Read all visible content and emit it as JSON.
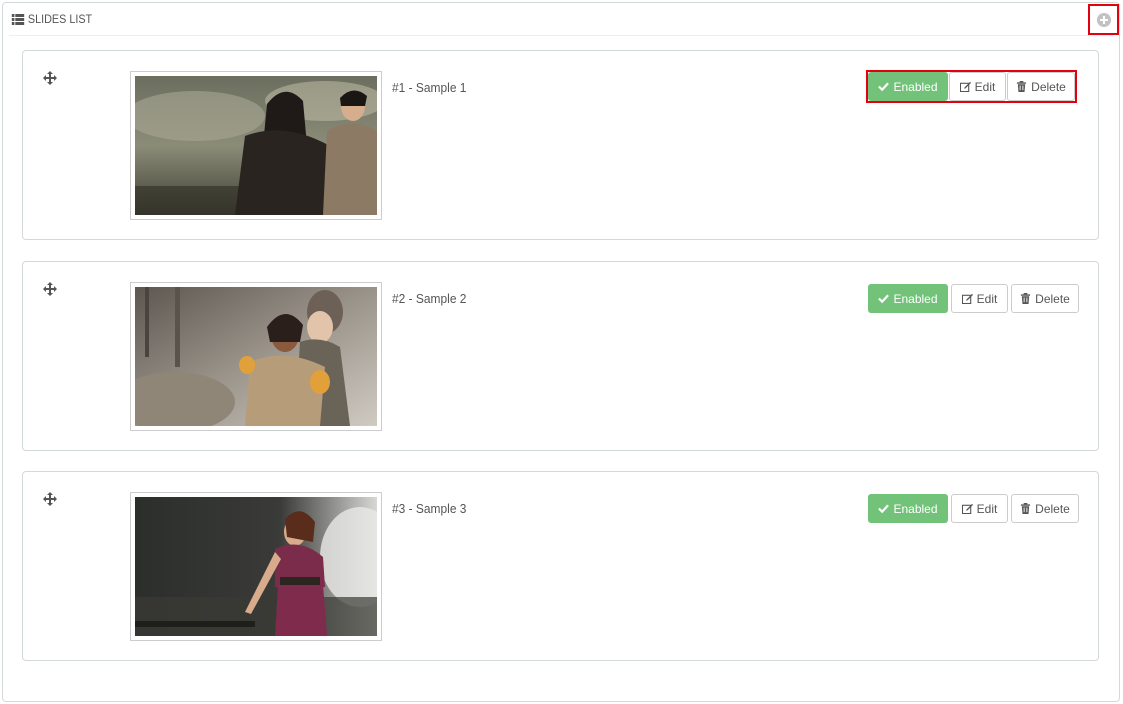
{
  "panel": {
    "title": "SLIDES LIST",
    "add_button_icon": "plus-circle-icon"
  },
  "slides": [
    {
      "title": "#1 - Sample 1",
      "status_label": "Enabled",
      "edit_label": "Edit",
      "delete_label": "Delete"
    },
    {
      "title": "#2 - Sample 2",
      "status_label": "Enabled",
      "edit_label": "Edit",
      "delete_label": "Delete"
    },
    {
      "title": "#3 - Sample 3",
      "status_label": "Enabled",
      "edit_label": "Edit",
      "delete_label": "Delete"
    }
  ],
  "colors": {
    "enabled": "#72c279",
    "highlight": "#e3000f",
    "border": "#d3d8db"
  }
}
